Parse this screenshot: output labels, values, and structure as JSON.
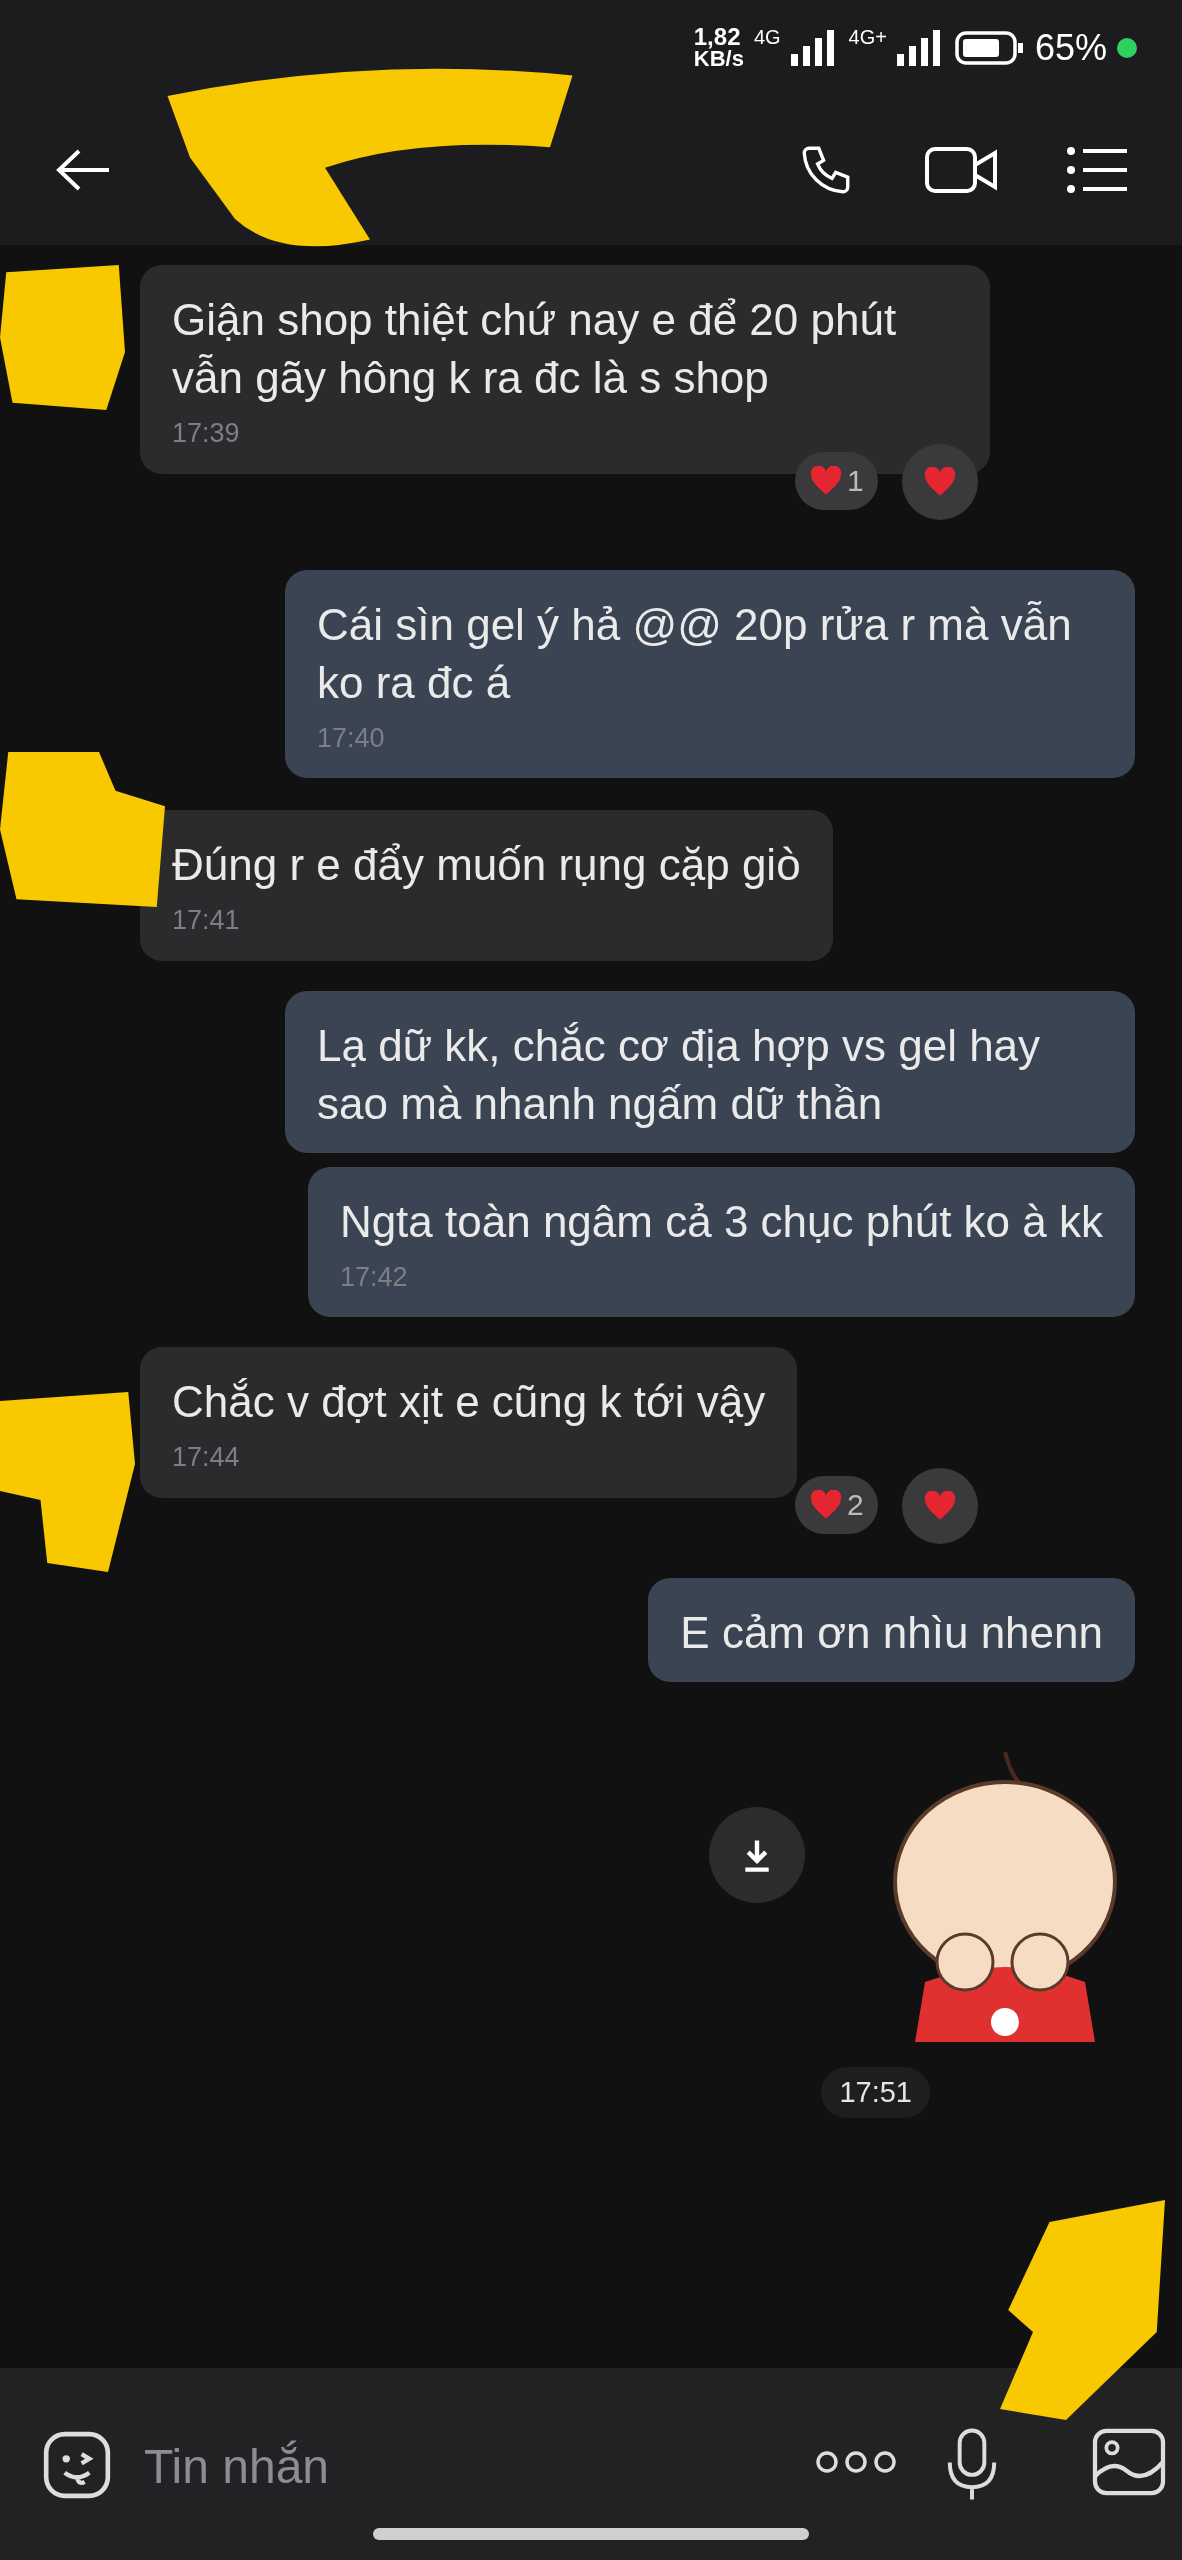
{
  "status_bar": {
    "speed": "1,82",
    "speed_unit": "KB/s",
    "network_1": "4G",
    "network_2": "4G+",
    "battery": "65%"
  },
  "messages": [
    {
      "kind": "incoming",
      "text": "Giận shop thiệt chứ nay e để 20 phút vẫn gãy hông k ra đc là s shop",
      "time": "17:39",
      "reaction_count": "1"
    },
    {
      "kind": "outgoing",
      "text": "Cái sìn gel ý hả @@ 20p rửa r mà vẫn ko ra đc á",
      "time": "17:40"
    },
    {
      "kind": "incoming",
      "text": "Đúng r e đẩy muốn rụng cặp giò",
      "time": "17:41"
    },
    {
      "kind": "outgoing",
      "text": "Lạ dữ kk, chắc cơ địa hợp vs gel hay sao mà nhanh ngấm dữ thần"
    },
    {
      "kind": "outgoing",
      "text": "Ngta toàn ngâm cả 3 chục phút ko à kk",
      "time": "17:42"
    },
    {
      "kind": "incoming",
      "text": "Chắc v đợt xịt e cũng k tới vậy",
      "time": "17:44",
      "reaction_count": "2"
    },
    {
      "kind": "outgoing",
      "text": "E cảm ơn nhìu nhenn"
    },
    {
      "kind": "sticker",
      "time": "17:51"
    }
  ],
  "composer": {
    "placeholder": "Tin nhắn"
  }
}
